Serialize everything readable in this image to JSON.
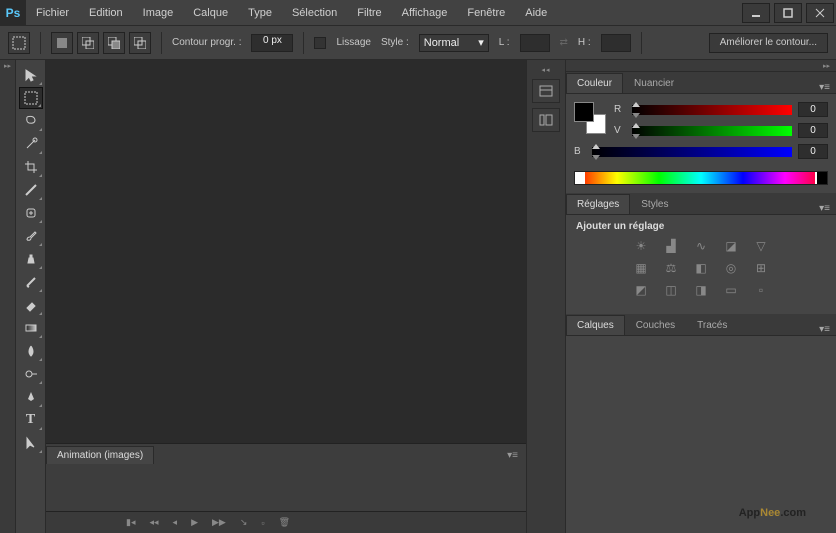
{
  "app": {
    "logo_text": "Ps"
  },
  "menu": [
    "Fichier",
    "Edition",
    "Image",
    "Calque",
    "Type",
    "Sélection",
    "Filtre",
    "Affichage",
    "Fenêtre",
    "Aide"
  ],
  "options": {
    "contour_label": "Contour progr. :",
    "contour_value": "0 px",
    "lissage_label": "Lissage",
    "style_label": "Style :",
    "style_value": "Normal",
    "largeur_label": "L :",
    "hauteur_label": "H :",
    "refine_button": "Améliorer le contour..."
  },
  "color_panel": {
    "tabs": [
      "Couleur",
      "Nuancier"
    ],
    "channels": [
      {
        "key": "R",
        "value": "0",
        "grad": "slider-r"
      },
      {
        "key": "V",
        "value": "0",
        "grad": "slider-g"
      },
      {
        "key": "B",
        "value": "0",
        "grad": "slider-b"
      }
    ]
  },
  "reglages_panel": {
    "tabs": [
      "Réglages",
      "Styles"
    ],
    "title": "Ajouter un réglage"
  },
  "layers_panel": {
    "tabs": [
      "Calques",
      "Couches",
      "Tracés"
    ]
  },
  "animation_panel": {
    "tab": "Animation (images)"
  },
  "watermark": {
    "a": "App",
    "n": "Nee",
    "c": ".com"
  }
}
